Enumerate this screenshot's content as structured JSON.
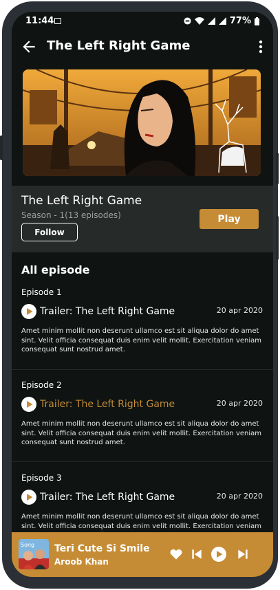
{
  "status_bar": {
    "time": "11:44",
    "battery": "77%"
  },
  "app_bar": {
    "title": "The Left Right Game"
  },
  "show": {
    "title": "The Left Right Game",
    "season": "Season - 1(13 episodes)",
    "follow_label": "Follow",
    "play_label": "Play"
  },
  "episodes_section": {
    "title": "All episode"
  },
  "episodes": [
    {
      "label": "Episode 1",
      "title": "Trailer: The Left Right Game",
      "date": "20 apr 2020",
      "description": "Amet minim mollit non deserunt ullamco est sit aliqua dolor do amet sint. Velit officia consequat duis enim velit mollit. Exercitation veniam consequat sunt nostrud amet.",
      "active": false
    },
    {
      "label": "Episode 2",
      "title": "Trailer: The Left Right Game",
      "date": "20 apr 2020",
      "description": "Amet minim mollit non deserunt ullamco est sit aliqua dolor do amet sint. Velit officia consequat duis enim velit mollit. Exercitation veniam consequat sunt nostrud amet.",
      "active": true
    },
    {
      "label": "Episode 3",
      "title": "Trailer: The Left Right Game",
      "date": "20 apr 2020",
      "description": "Amet minim mollit non deserunt ullamco est sit aliqua dolor do amet sint. Velit officia consequat duis enim velit mollit. Exercitation veniam consequat sunt nostrud amet.",
      "active": false
    }
  ],
  "mini_player": {
    "song": "Teri Cute Si Smile",
    "artist": "Aroob Khan",
    "thumb_text": "Song"
  },
  "colors": {
    "accent": "#c68c35",
    "background": "#0f1412",
    "card": "#262a29"
  },
  "icons": [
    "image-icon",
    "dnd-icon",
    "wifi-icon",
    "signal-icon",
    "battery-icon",
    "back-arrow-icon",
    "more-vert-icon",
    "play-circle-icon",
    "heart-icon",
    "skip-previous-icon",
    "skip-next-icon"
  ]
}
